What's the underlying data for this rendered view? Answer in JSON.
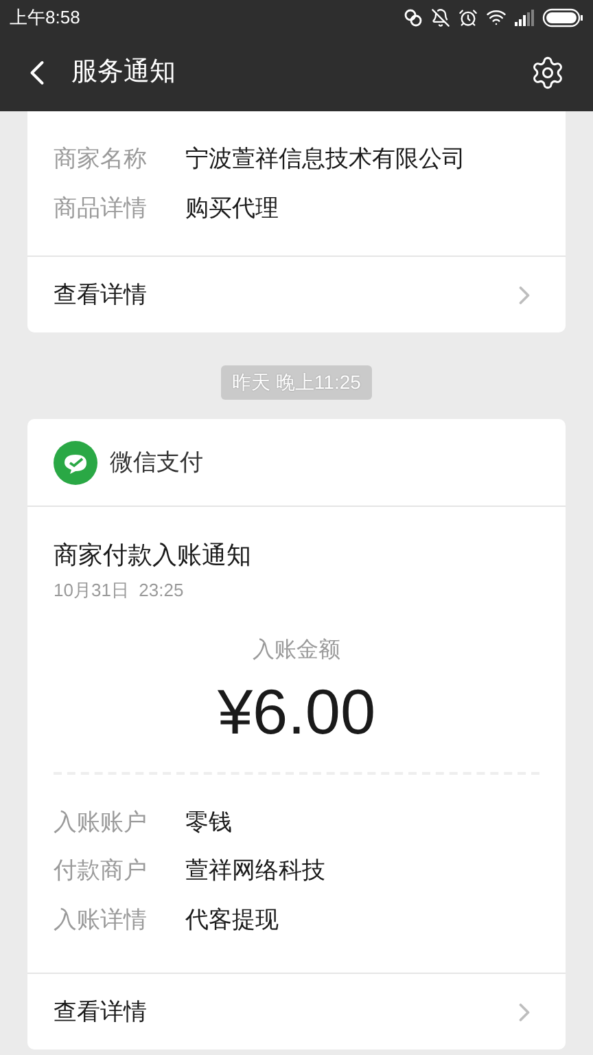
{
  "status_bar": {
    "time": "上午8:58"
  },
  "nav": {
    "title": "服务通知"
  },
  "cards": [
    {
      "fields": [
        {
          "label": "商家名称",
          "value": "宁波萱祥信息技术有限公司"
        },
        {
          "label": "商品详情",
          "value": "购买代理"
        }
      ],
      "footer": "查看详情"
    },
    {
      "timestamp": "昨天 晚上11:25",
      "brand": "微信支付",
      "title": "商家付款入账通知",
      "date": "10月31日  23:25",
      "amount_label": "入账金额",
      "amount": "¥6.00",
      "fields": [
        {
          "label": "入账账户",
          "value": "零钱"
        },
        {
          "label": "付款商户",
          "value": "萱祥网络科技"
        },
        {
          "label": "入账详情",
          "value": "代客提现"
        }
      ],
      "footer": "查看详情"
    }
  ]
}
